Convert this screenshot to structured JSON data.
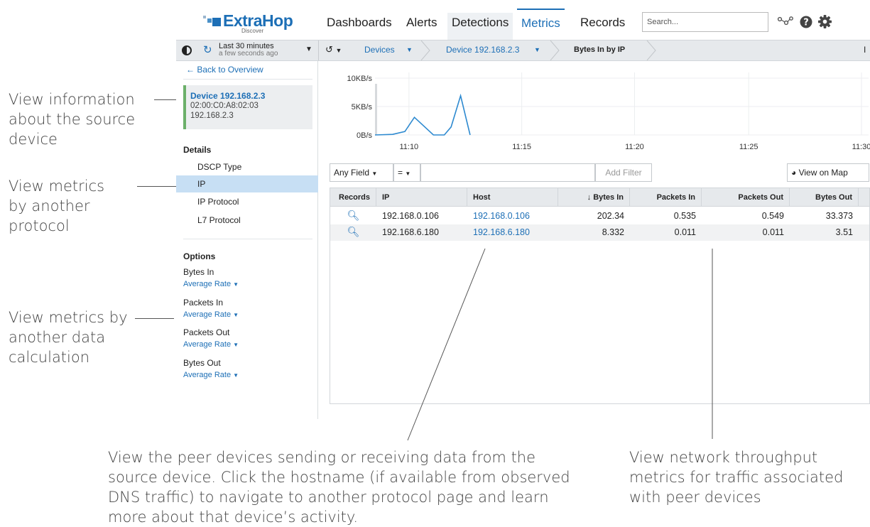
{
  "annotations": {
    "source_device": [
      "View information",
      "about the source",
      "device"
    ],
    "other_protocol": [
      "View metrics",
      "by another",
      "protocol"
    ],
    "data_calc": [
      "View metrics by",
      "another data",
      "calculation"
    ],
    "peer_devices": [
      "View the peer devices sending or receiving data from the",
      "source device. Click the hostname (if available from observed",
      "DNS traffic) to navigate to another protocol page and learn",
      "more about that device’s activity."
    ],
    "throughput": [
      "View network throughput",
      "metrics for traffic associated",
      "with peer devices"
    ]
  },
  "logo": {
    "name": "ExtraHop",
    "sub": "Discover"
  },
  "nav": {
    "tabs": [
      "Dashboards",
      "Alerts",
      "Detections",
      "Metrics",
      "Records"
    ],
    "active": "Metrics",
    "search_placeholder": "Search..."
  },
  "toolbar": {
    "time_range": "Last 30 minutes",
    "updated": "a few seconds ago",
    "breadcrumbs": [
      "Devices",
      "Device 192.168.2.3",
      "Bytes In by IP"
    ],
    "right_marker": "I"
  },
  "sidebar": {
    "back_label": "Back to Overview",
    "device": {
      "name": "Device 192.168.2.3",
      "mac": "02:00:C0:A8:02:03",
      "ip": "192.168.2.3"
    },
    "details_title": "Details",
    "details_items": [
      "DSCP Type",
      "IP",
      "IP Protocol",
      "L7 Protocol"
    ],
    "selected_item": "IP",
    "options_title": "Options",
    "options": [
      {
        "label": "Bytes In",
        "value": "Average Rate"
      },
      {
        "label": "Packets In",
        "value": "Average Rate"
      },
      {
        "label": "Packets Out",
        "value": "Average Rate"
      },
      {
        "label": "Bytes Out",
        "value": "Average Rate"
      }
    ]
  },
  "chart_data": {
    "type": "line",
    "yticks": [
      "10KB/s",
      "5KB/s",
      "0B/s"
    ],
    "xticks": [
      "11:10",
      "11:15",
      "11:20",
      "11:25",
      "11:30"
    ],
    "xtick_positions": [
      11.167,
      11.25,
      11.333,
      11.417,
      11.5
    ],
    "ylim": [
      0,
      10
    ],
    "series": [
      {
        "x": [
          11.142,
          11.155,
          11.164,
          11.171,
          11.185,
          11.193,
          11.198,
          11.205,
          11.212
        ],
        "y": [
          0,
          0.1,
          0.6,
          3.1,
          0,
          0,
          1.4,
          6.9,
          0
        ]
      }
    ],
    "xlim": [
      11.142,
      11.5
    ],
    "color": "#2e8ad0"
  },
  "filter": {
    "field": "Any Field",
    "operator": "=",
    "value": "",
    "add_button": "Add Filter",
    "map_button": "View on Map"
  },
  "table": {
    "headers": [
      "Records",
      "IP",
      "Host",
      "↓ Bytes In",
      "Packets In",
      "Packets Out",
      "Bytes Out"
    ],
    "rows": [
      [
        "192.168.0.106",
        "192.168.0.106",
        "202.34",
        "0.535",
        "0.549",
        "33.373"
      ],
      [
        "192.168.6.180",
        "192.168.6.180",
        "8.332",
        "0.011",
        "0.011",
        "3.51"
      ]
    ]
  }
}
